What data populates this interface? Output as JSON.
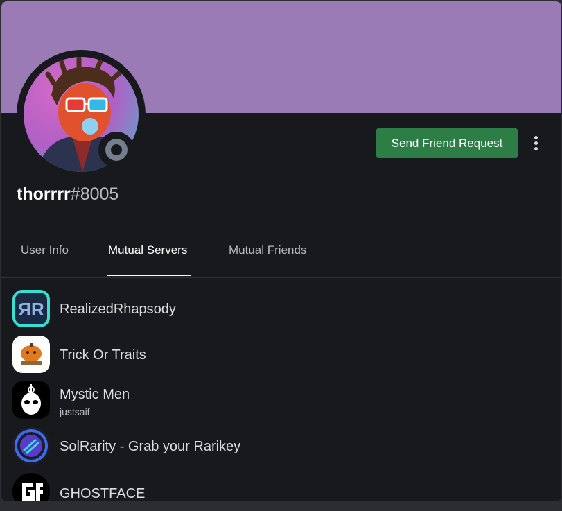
{
  "profile": {
    "username": "thorrrr",
    "discriminator": "#8005",
    "status": "offline",
    "banner_color": "#9a7bb6",
    "avatar_icon": "cartoon-avatar-icon"
  },
  "actions": {
    "send_friend_request": "Send Friend Request",
    "more_icon": "vertical-ellipsis-icon"
  },
  "tabs": [
    {
      "label": "User Info",
      "active": false
    },
    {
      "label": "Mutual Servers",
      "active": true
    },
    {
      "label": "Mutual Friends",
      "active": false
    }
  ],
  "servers": [
    {
      "name": "RealizedRhapsody",
      "nickname": "",
      "icon": "rr-logo-icon"
    },
    {
      "name": "Trick Or Traits",
      "nickname": "",
      "icon": "pumpkin-logo-icon"
    },
    {
      "name": "Mystic Men",
      "nickname": "justsaif",
      "icon": "mystic-mask-icon"
    },
    {
      "name": "SolRarity - Grab your Rarikey",
      "nickname": "",
      "icon": "solrarity-logo-icon"
    },
    {
      "name": "GHOSTFACE",
      "nickname": "",
      "icon": "ghostface-logo-icon"
    }
  ],
  "colors": {
    "background": "#18191c",
    "accent_green": "#2d7d46",
    "status_offline": "#747f8d"
  }
}
